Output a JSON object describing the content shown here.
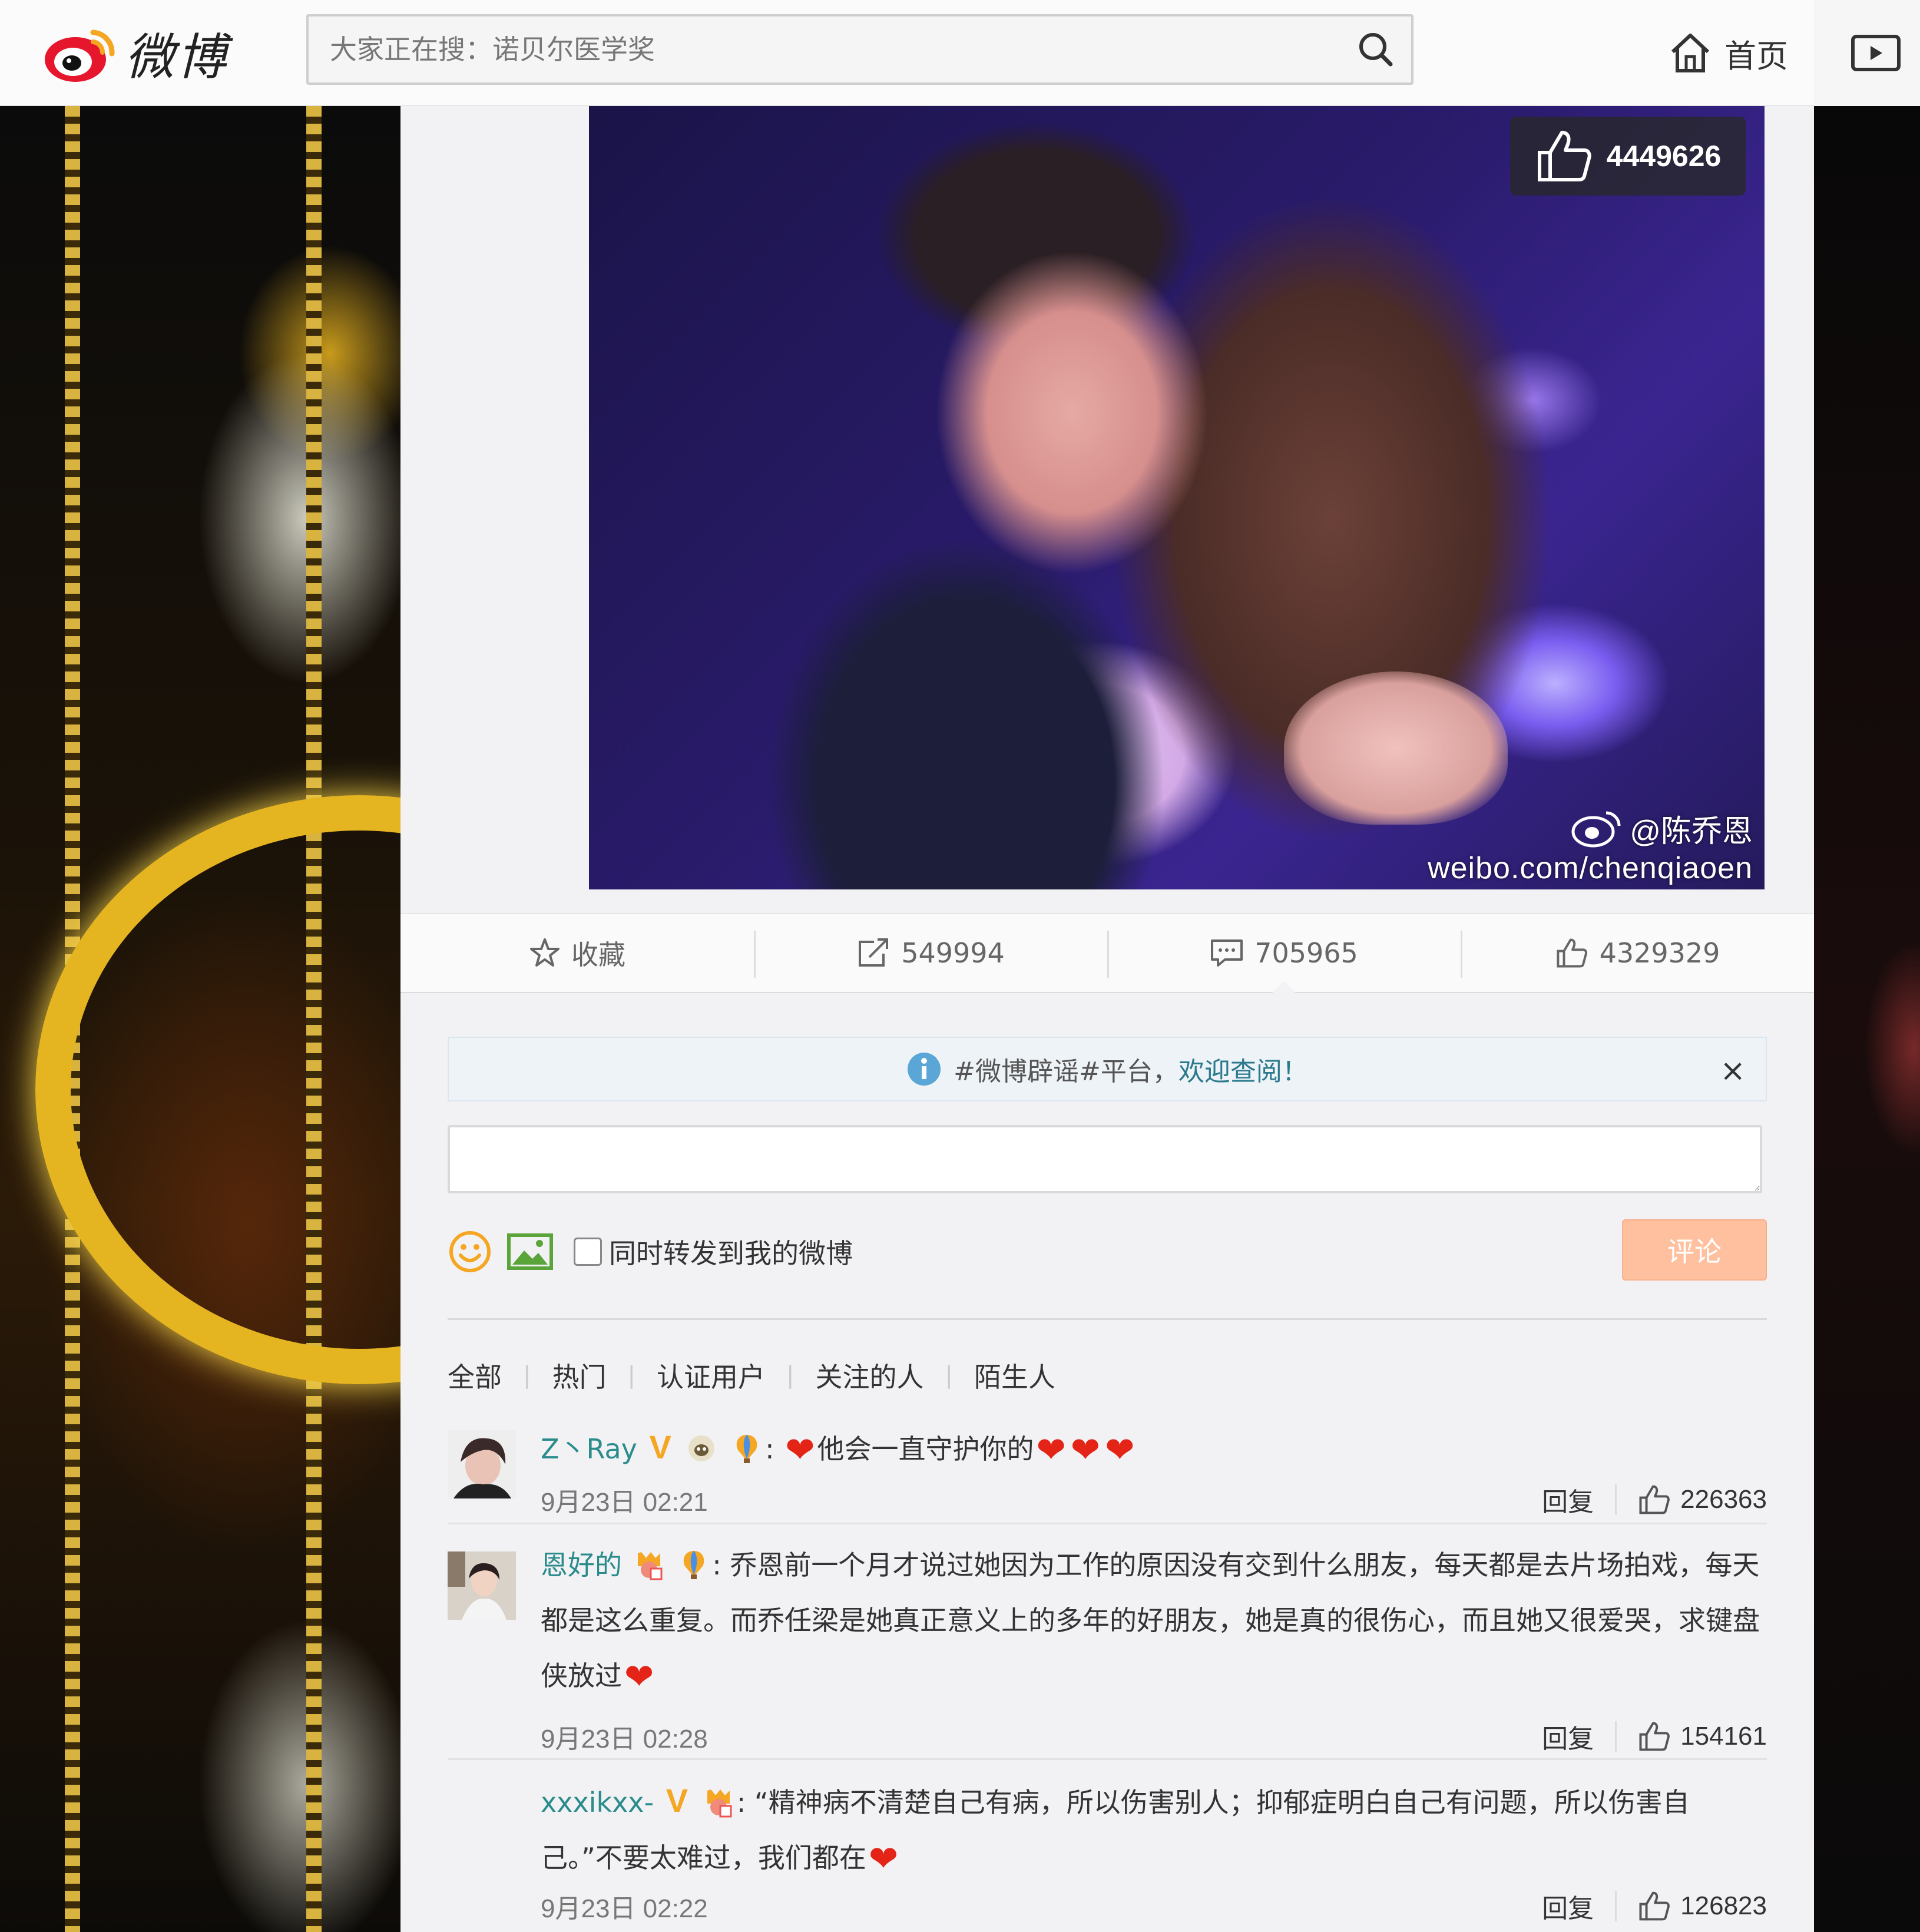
{
  "header": {
    "logo_text": "微博",
    "search_placeholder": "大家正在搜：诺贝尔医学奖",
    "nav_home_label": "首页"
  },
  "post": {
    "photo_like_count": "4449626",
    "watermark_handle": "@陈乔恩",
    "watermark_url": "weibo.com/chenqiaoen"
  },
  "actions": {
    "favorite_label": "收藏",
    "repost_count": "549994",
    "comment_count": "705965",
    "like_count": "4329329"
  },
  "notice": {
    "text": "#微博辟谣#平台，",
    "link": "欢迎查阅！",
    "close": "×"
  },
  "composer": {
    "input_placeholder": "",
    "repost_label": "同时转发到我的微博",
    "submit_label": "评论"
  },
  "filters": [
    "全部",
    "热门",
    "认证用户",
    "关注的人",
    "陌生人"
  ],
  "comments": [
    {
      "user": "Z丶Ray",
      "text": "他会一直守护你的",
      "time": "9月23日 02:21",
      "reply": "回复",
      "likes": "226363"
    },
    {
      "user": "恩好的",
      "text": "乔恩前一个月才说过她因为工作的原因没有交到什么朋友，每天都是去片场拍戏，每天都是这么重复。而乔任梁是她真正意义上的多年的好朋友，她是真的很伤心，而且她又很爱哭，求键盘侠放过",
      "time": "9月23日 02:28",
      "reply": "回复",
      "likes": "154161"
    },
    {
      "user": "xxxikxx-",
      "text": "“精神病不清楚自己有病，所以伤害别人；抑郁症明白自己有问题，所以伤害自己。”不要太难过，我们都在",
      "time": "9月23日 02:22",
      "reply": "回复",
      "likes": "126823"
    }
  ],
  "colors": {
    "accent_teal": "#2b8c8c",
    "submit_orange": "#ffc09f",
    "heart_red": "#e32416",
    "verified_orange": "#f5a623"
  }
}
